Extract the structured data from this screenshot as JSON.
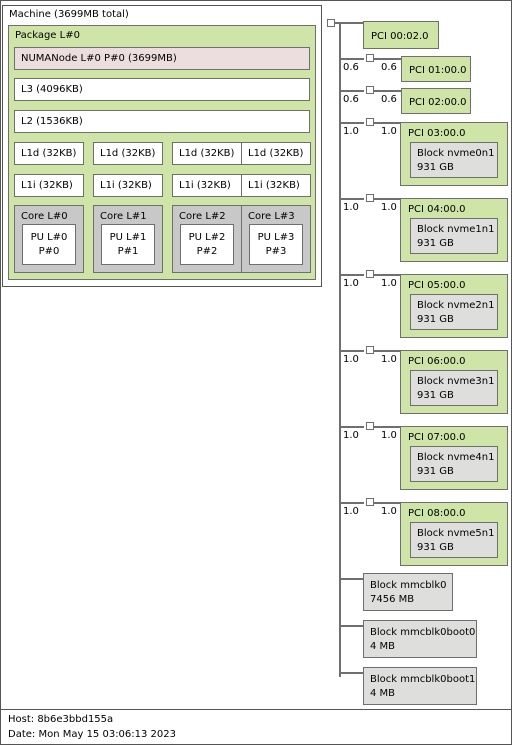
{
  "machine": {
    "label": "Machine (3699MB total)",
    "package": {
      "label": "Package L#0",
      "numanode": {
        "label": "NUMANode L#0 P#0 (3699MB)"
      },
      "caches": [
        {
          "label": "L3 (4096KB)"
        },
        {
          "label": "L2 (1536KB)"
        }
      ],
      "l1d": [
        {
          "label": "L1d (32KB)"
        },
        {
          "label": "L1d (32KB)"
        },
        {
          "label": "L1d (32KB)"
        },
        {
          "label": "L1d (32KB)"
        }
      ],
      "l1i": [
        {
          "label": "L1i (32KB)"
        },
        {
          "label": "L1i (32KB)"
        },
        {
          "label": "L1i (32KB)"
        },
        {
          "label": "L1i (32KB)"
        }
      ],
      "cores": [
        {
          "label": "Core L#0",
          "pu_line1": "PU L#0",
          "pu_line2": "P#0"
        },
        {
          "label": "Core L#1",
          "pu_line1": "PU L#1",
          "pu_line2": "P#1"
        },
        {
          "label": "Core L#2",
          "pu_line1": "PU L#2",
          "pu_line2": "P#2"
        },
        {
          "label": "Core L#3",
          "pu_line1": "PU L#3",
          "pu_line2": "P#3"
        }
      ]
    }
  },
  "io": {
    "pci_devices": [
      {
        "label": "PCI 00:02.0",
        "bw_left": "",
        "bw_right": "",
        "osdev": null
      },
      {
        "label": "PCI 01:00.0",
        "bw_left": "0.6",
        "bw_right": "0.6",
        "osdev": null
      },
      {
        "label": "PCI 02:00.0",
        "bw_left": "0.6",
        "bw_right": "0.6",
        "osdev": null
      },
      {
        "label": "PCI 03:00.0",
        "bw_left": "1.0",
        "bw_right": "1.0",
        "osdev": {
          "line1": "Block nvme0n1",
          "line2": "931 GB"
        }
      },
      {
        "label": "PCI 04:00.0",
        "bw_left": "1.0",
        "bw_right": "1.0",
        "osdev": {
          "line1": "Block nvme1n1",
          "line2": "931 GB"
        }
      },
      {
        "label": "PCI 05:00.0",
        "bw_left": "1.0",
        "bw_right": "1.0",
        "osdev": {
          "line1": "Block nvme2n1",
          "line2": "931 GB"
        }
      },
      {
        "label": "PCI 06:00.0",
        "bw_left": "1.0",
        "bw_right": "1.0",
        "osdev": {
          "line1": "Block nvme3n1",
          "line2": "931 GB"
        }
      },
      {
        "label": "PCI 07:00.0",
        "bw_left": "1.0",
        "bw_right": "1.0",
        "osdev": {
          "line1": "Block nvme4n1",
          "line2": "931 GB"
        }
      },
      {
        "label": "PCI 08:00.0",
        "bw_left": "1.0",
        "bw_right": "1.0",
        "osdev": {
          "line1": "Block nvme5n1",
          "line2": "931 GB"
        }
      }
    ],
    "block_devices": [
      {
        "line1": "Block mmcblk0",
        "line2": "7456 MB"
      },
      {
        "line1": "Block mmcblk0boot0",
        "line2": "4 MB"
      },
      {
        "line1": "Block mmcblk0boot1",
        "line2": "4 MB"
      }
    ]
  },
  "footer": {
    "host": "Host: 8b6e3bbd155a",
    "date": "Date: Mon May 15 03:06:13 2023"
  },
  "colors": {
    "package": "#cfe5a8",
    "numanode": "#ecdede",
    "core": "#c8c8c8",
    "osdev": "#dededc",
    "border": "#6f6f6f",
    "frame": "#555555",
    "background": "#ffffff"
  }
}
